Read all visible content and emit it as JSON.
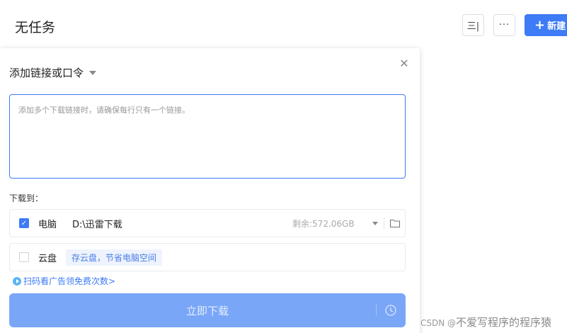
{
  "header": {
    "title": "无任务",
    "sort_icon_glyph": "三|",
    "more_icon_glyph": "···",
    "new_button_label": "新建"
  },
  "dialog": {
    "title": "添加链接或口令",
    "input_placeholder": "添加多个下载链接时，请确保每行只有一个链接。",
    "save_to_label": "下载到：",
    "pc_row": {
      "label": "电脑",
      "path": "D:\\迅雷下载",
      "free_space": "剩余:572.06GB",
      "checked": true
    },
    "cloud_row": {
      "label": "云盘",
      "tip": "存云盘，节省电脑空间",
      "checked": false
    },
    "ad_link": "扫码看广告领免费次数>",
    "download_button": "立即下载"
  },
  "watermark": {
    "prefix": "CSDN @",
    "name": "不爱写程序的程序猿"
  },
  "colors": {
    "accent": "#3d7bf7",
    "button_disabled": "#7aa6f7"
  }
}
